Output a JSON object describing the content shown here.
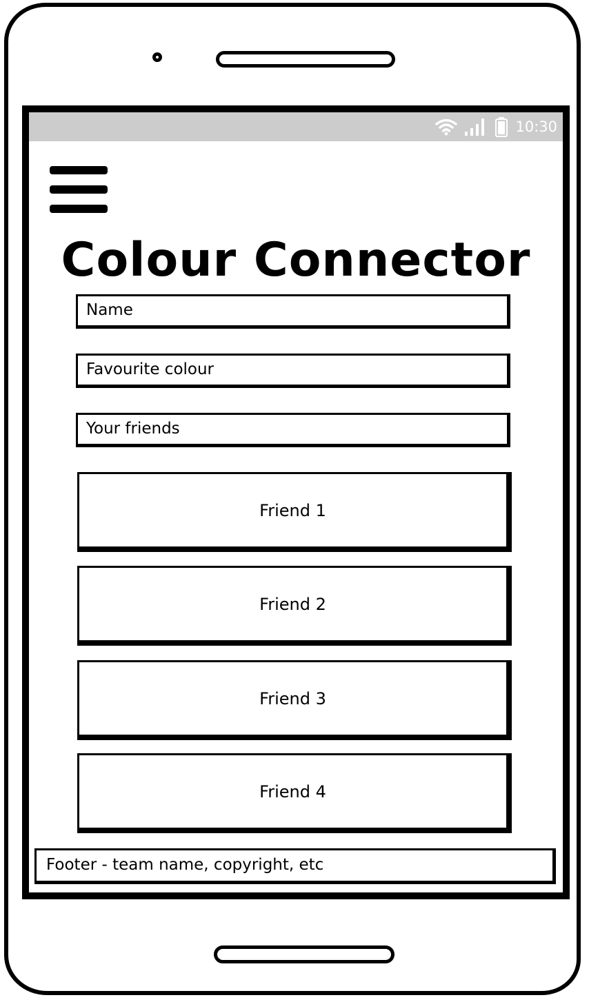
{
  "status_bar": {
    "time": "10:30",
    "icons": [
      "wifi-icon",
      "signal-icon",
      "battery-icon"
    ]
  },
  "menu": {
    "icon": "hamburger-menu-icon"
  },
  "page_title": "Colour Connector",
  "form": {
    "name_placeholder": "Name",
    "colour_placeholder": "Favourite colour",
    "friends_placeholder": "Your friends"
  },
  "friends": [
    {
      "label": "Friend 1"
    },
    {
      "label": "Friend 2"
    },
    {
      "label": "Friend 3"
    },
    {
      "label": "Friend 4"
    }
  ],
  "footer": {
    "text": "Footer - team name, copyright, etc"
  }
}
